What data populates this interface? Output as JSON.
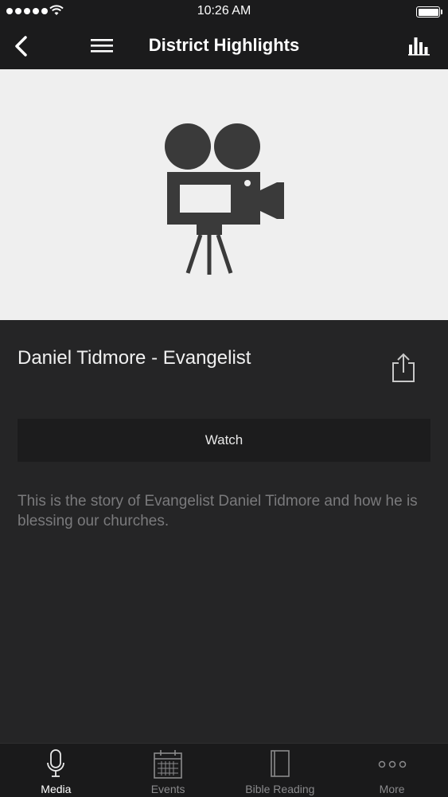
{
  "status_bar": {
    "time": "10:26 AM"
  },
  "nav": {
    "title": "District Highlights"
  },
  "media": {
    "title": "Daniel Tidmore - Evangelist",
    "watch_label": "Watch",
    "description": "This is the story of Evangelist Daniel Tidmore and how he is blessing our churches."
  },
  "tabs": [
    {
      "label": "Media",
      "icon": "microphone-icon",
      "active": true
    },
    {
      "label": "Events",
      "icon": "calendar-icon",
      "active": false
    },
    {
      "label": "Bible Reading",
      "icon": "book-icon",
      "active": false
    },
    {
      "label": "More",
      "icon": "more-dots-icon",
      "active": false
    }
  ],
  "colors": {
    "background": "#252526",
    "bar": "#1b1b1c",
    "hero_background": "#efefef",
    "camera_icon": "#3a3a3a",
    "description_text": "#7a7a7c"
  }
}
